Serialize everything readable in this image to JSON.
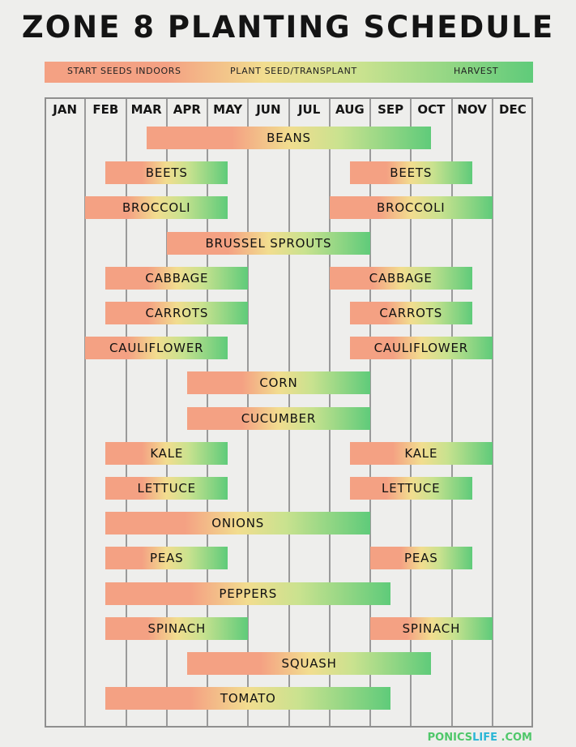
{
  "title": "ZONE 8 PLANTING SCHEDULE",
  "legend": {
    "stages": [
      "START SEEDS INDOORS",
      "PLANT SEED/TRANSPLANT",
      "HARVEST"
    ],
    "colors": {
      "start": "#f4a183",
      "plant": "#f2dd8f",
      "harvest": "#5fcb7a"
    }
  },
  "logo": {
    "part1": "PONICS",
    "part2": "LIFE",
    "part3": ".COM",
    "color1": "#4fc76a",
    "color2": "#2ab6d6"
  },
  "chart_data": {
    "type": "gantt",
    "title": "ZONE 8 PLANTING SCHEDULE",
    "x_unit": "month (0 = start of JAN, 12 = end of DEC)",
    "months": [
      "JAN",
      "FEB",
      "MAR",
      "APR",
      "MAY",
      "JUN",
      "JUL",
      "AUG",
      "SEP",
      "OCT",
      "NOV",
      "DEC"
    ],
    "xlim": [
      0,
      12
    ],
    "legend": [
      "START SEEDS INDOORS",
      "PLANT SEED/TRANSPLANT",
      "HARVEST"
    ],
    "rows": [
      {
        "crop": "BEANS",
        "spans": [
          [
            2.5,
            9.5
          ]
        ]
      },
      {
        "crop": "BEETS",
        "spans": [
          [
            1.5,
            4.5
          ],
          [
            7.5,
            10.5
          ]
        ]
      },
      {
        "crop": "BROCCOLI",
        "spans": [
          [
            1.0,
            4.5
          ],
          [
            7.0,
            11.0
          ]
        ]
      },
      {
        "crop": "BRUSSEL SPROUTS",
        "spans": [
          [
            3.0,
            8.0
          ]
        ]
      },
      {
        "crop": "CABBAGE",
        "spans": [
          [
            1.5,
            5.0
          ],
          [
            7.0,
            10.5
          ]
        ]
      },
      {
        "crop": "CARROTS",
        "spans": [
          [
            1.5,
            5.0
          ],
          [
            7.5,
            10.5
          ]
        ]
      },
      {
        "crop": "CAULIFLOWER",
        "spans": [
          [
            1.0,
            4.5
          ],
          [
            7.5,
            11.0
          ]
        ]
      },
      {
        "crop": "CORN",
        "spans": [
          [
            3.5,
            8.0
          ]
        ]
      },
      {
        "crop": "CUCUMBER",
        "spans": [
          [
            3.5,
            8.0
          ]
        ]
      },
      {
        "crop": "KALE",
        "spans": [
          [
            1.5,
            4.5
          ],
          [
            7.5,
            11.0
          ]
        ]
      },
      {
        "crop": "LETTUCE",
        "spans": [
          [
            1.5,
            4.5
          ],
          [
            7.5,
            10.5
          ]
        ]
      },
      {
        "crop": "ONIONS",
        "spans": [
          [
            1.5,
            8.0
          ]
        ]
      },
      {
        "crop": "PEAS",
        "spans": [
          [
            1.5,
            4.5
          ],
          [
            8.0,
            10.5
          ]
        ]
      },
      {
        "crop": "PEPPERS",
        "spans": [
          [
            1.5,
            8.5
          ]
        ]
      },
      {
        "crop": "SPINACH",
        "spans": [
          [
            1.5,
            5.0
          ],
          [
            8.0,
            11.0
          ]
        ]
      },
      {
        "crop": "SQUASH",
        "spans": [
          [
            3.5,
            9.5
          ]
        ]
      },
      {
        "crop": "TOMATO",
        "spans": [
          [
            1.5,
            8.5
          ]
        ]
      }
    ]
  }
}
